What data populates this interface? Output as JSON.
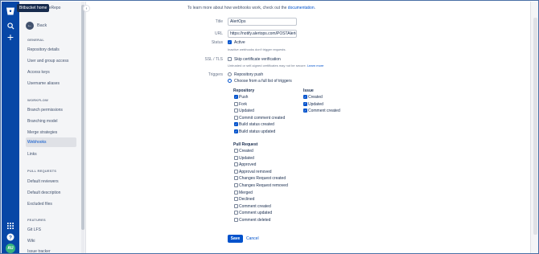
{
  "rail": {
    "tooltip": "Bitbucket home",
    "icons": [
      "bitbucket-logo",
      "search-icon",
      "plus-icon",
      "app-switcher-icon",
      "help-icon",
      "avatar"
    ],
    "avatar_initials": "AU"
  },
  "sidebar": {
    "repo_name": "apleRepo",
    "back_label": "Back",
    "sections": {
      "general": "GENERAL",
      "workflow": "WORKFLOW",
      "pull_requests": "PULL REQUESTS",
      "features": "FEATURES"
    },
    "general_items": [
      "Repository details",
      "User and group access",
      "Access keys",
      "Username aliases"
    ],
    "workflow_items": [
      "Branch permissions",
      "Branching model",
      "Merge strategies",
      "Webhooks",
      "Links"
    ],
    "pr_items": [
      "Default reviewers",
      "Default description",
      "Excluded files"
    ],
    "feature_items": [
      "Git LFS",
      "Wiki",
      "Issue tracker"
    ]
  },
  "form": {
    "intro_text": "To learn more about how webhooks work, check out the ",
    "intro_link": "documentation",
    "intro_end": ".",
    "title_label": "Title",
    "title_value": "AlertOps",
    "url_label": "URL",
    "url_value": "https://notify.alertops.com/POSTAlert4",
    "status_label": "Status",
    "status_active": "Active",
    "status_hint": "Inactive webhooks don't trigger requests.",
    "ssl_label": "SSL / TLS",
    "ssl_option": "Skip certificate verification",
    "ssl_hint": "Untrusted or self-signed certificates may not be secure. ",
    "ssl_learn": "Learn more",
    "triggers_label": "Triggers",
    "trigger_push": "Repository push",
    "trigger_choose": "Choose from a full list of triggers",
    "repository_heading": "Repository",
    "repository_items": [
      {
        "label": "Push",
        "checked": true
      },
      {
        "label": "Fork",
        "checked": false
      },
      {
        "label": "Updated",
        "checked": false
      },
      {
        "label": "Commit comment created",
        "checked": false
      },
      {
        "label": "Build status created",
        "checked": true
      },
      {
        "label": "Build status updated",
        "checked": true
      }
    ],
    "issue_heading": "Issue",
    "issue_items": [
      {
        "label": "Created",
        "checked": true
      },
      {
        "label": "Updated",
        "checked": true
      },
      {
        "label": "Comment created",
        "checked": true
      }
    ],
    "pr_heading": "Pull Request",
    "pr_items": [
      {
        "label": "Created",
        "checked": false
      },
      {
        "label": "Updated",
        "checked": false
      },
      {
        "label": "Approved",
        "checked": false
      },
      {
        "label": "Approval removed",
        "checked": false
      },
      {
        "label": "Changes Request created",
        "checked": false
      },
      {
        "label": "Changes Request removed",
        "checked": false
      },
      {
        "label": "Merged",
        "checked": false
      },
      {
        "label": "Declined",
        "checked": false
      },
      {
        "label": "Comment created",
        "checked": false
      },
      {
        "label": "Comment updated",
        "checked": false
      },
      {
        "label": "Comment deleted",
        "checked": false
      }
    ],
    "save_label": "Save",
    "cancel_label": "Cancel"
  },
  "colors": {
    "rail": "#0747a6",
    "primary": "#0052cc",
    "sidebar_bg": "#f4f5f7"
  }
}
